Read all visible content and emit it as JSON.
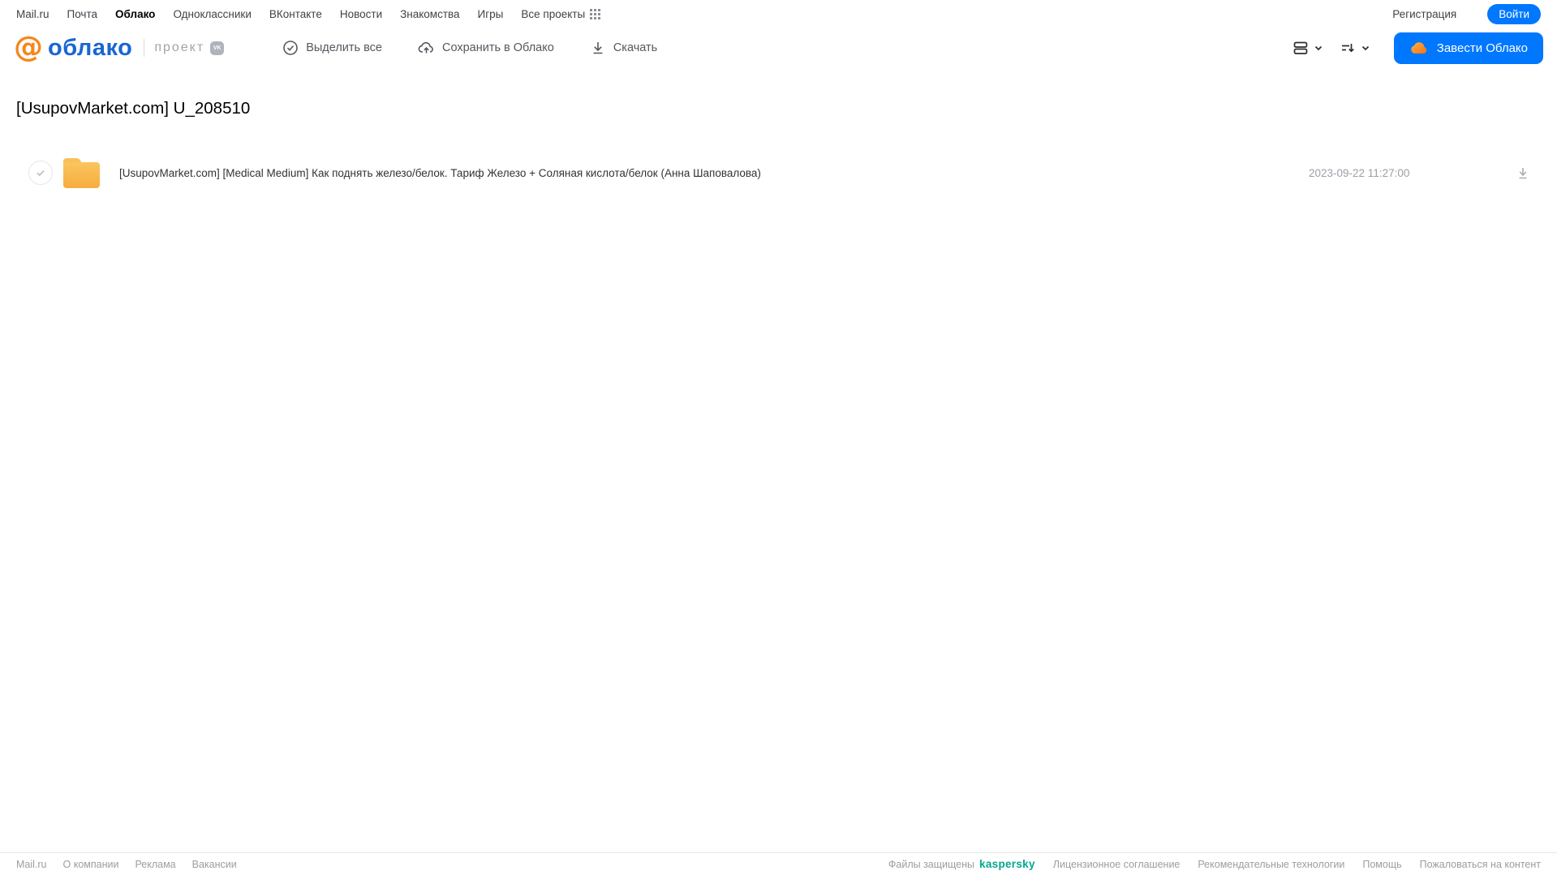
{
  "topnav": {
    "links": [
      "Mail.ru",
      "Почта",
      "Облако",
      "Одноклассники",
      "ВКонтакте",
      "Новости",
      "Знакомства",
      "Игры",
      "Все проекты"
    ],
    "registration_label": "Регистрация",
    "login_label": "Войти"
  },
  "header": {
    "logo_text": "облако",
    "logo_at": "@",
    "project_label": "проект",
    "vk_badge": "VK",
    "actions": [
      {
        "label": "Выделить все",
        "icon": "check-circle-icon"
      },
      {
        "label": "Сохранить в Облако",
        "icon": "cloud-upload-icon"
      },
      {
        "label": "Скачать",
        "icon": "download-icon"
      }
    ],
    "view_control_icon": "list-view-icon",
    "sort_control_icon": "sort-icon",
    "get_cloud_label": "Завести Облако"
  },
  "main": {
    "title": "[UsupovMarket.com] U_208510",
    "files": [
      {
        "name": "[UsupovMarket.com] [Medical Medium] Как поднять железо/белок. Тариф Железо + Соляная кислота/белок (Анна Шаповалова)",
        "date": "2023-09-22 11:27:00",
        "type": "folder"
      }
    ]
  },
  "footer": {
    "left_links": [
      "Mail.ru",
      "О компании",
      "Реклама",
      "Вакансии"
    ],
    "protected_label": "Файлы защищены",
    "kaspersky_label": "kaspersky",
    "right_links": [
      "Лицензионное соглашение",
      "Рекомендательные технологии",
      "Помощь",
      "Пожаловаться на контент"
    ]
  },
  "colors": {
    "accent_blue": "#0077FF",
    "logo_blue": "#1966D2",
    "logo_orange": "#F7861C",
    "folder_yellow": "#F6AD3F",
    "kaspersky_green": "#00A88E"
  }
}
